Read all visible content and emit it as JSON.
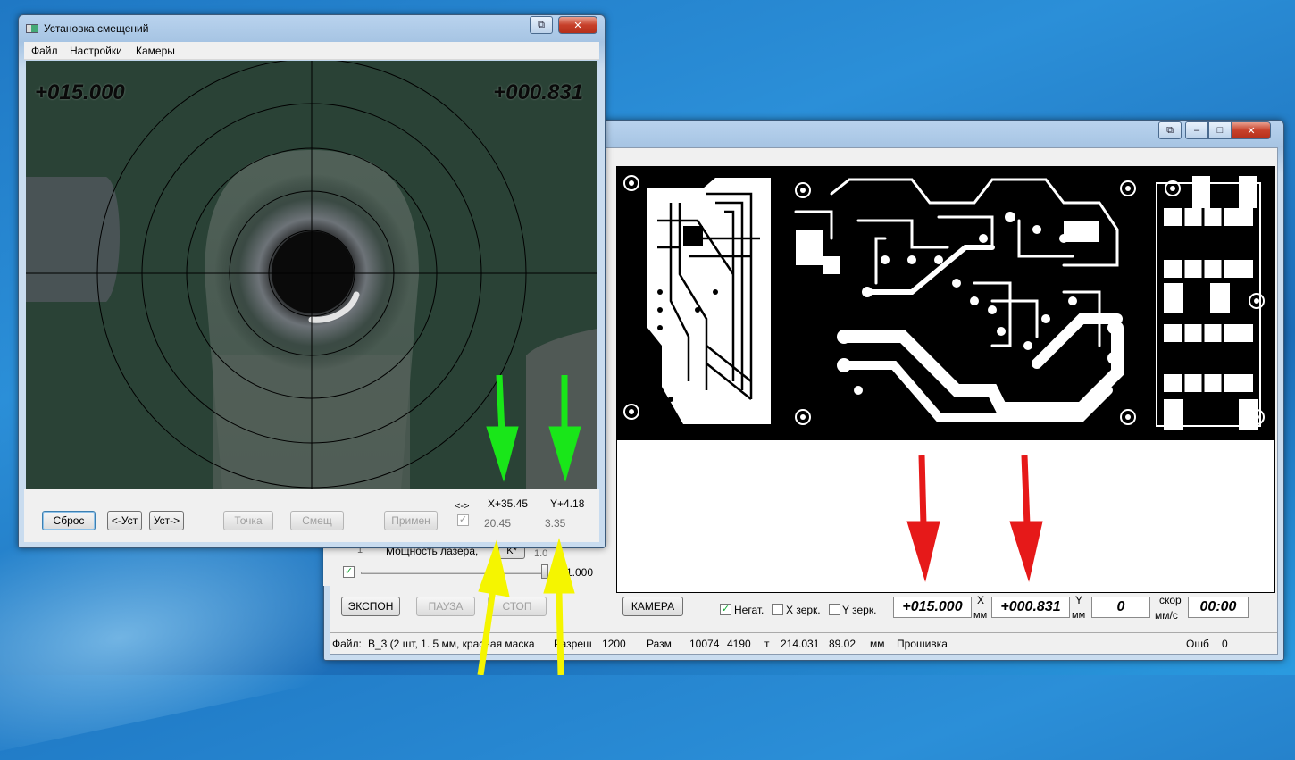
{
  "desktop": {
    "accent": "#1f78c4"
  },
  "offset_dialog": {
    "title": "Установка смещений",
    "menu": [
      "Файл",
      "Настройки",
      "Камеры"
    ],
    "camera": {
      "x_readout": "+015.000",
      "y_readout": "+000.831"
    },
    "buttons": {
      "reset": "Сброс",
      "set_left": "<-Уст",
      "set_right": "Уст->",
      "point": "Точка",
      "offset": "Смещ",
      "apply": "Примен"
    },
    "swap_label": "<->",
    "x_label": "X+35.45",
    "y_label": "Y+4.18",
    "x_value": "20.45",
    "y_value": "3.35"
  },
  "main_window": {
    "laser_power_label": "Мощность лазера,",
    "laser_power_btn": "K*",
    "partial_1": "1",
    "partial_10": "1.0",
    "laser_power_value": "1.000",
    "buttons": {
      "expose": "ЭКСПОН",
      "pause": "ПАУЗА",
      "stop": "СТОП",
      "camera": "КАМЕРА"
    },
    "checkboxes": {
      "negative": "Негат.",
      "x_mirror": "X зерк.",
      "y_mirror": "Y зерк."
    },
    "readouts": {
      "x": "+015.000",
      "y": "+000.831",
      "speed": "0",
      "time": "00:00"
    },
    "axis_labels": {
      "x": "X",
      "y": "Y",
      "unit": "мм",
      "speed_top": "скор",
      "speed_bottom": "мм/с"
    },
    "status": {
      "file_label": "Файл:",
      "file_value": "B_3 (2 шт, 1. 5 мм, красная маска",
      "resolution_label": "Разреш",
      "resolution_value": "1200",
      "size_label": "Разм",
      "size_w": "10074",
      "size_h": "4190",
      "t_label": "т",
      "t_w": "214.031",
      "t_h": "89.02",
      "unit": "мм",
      "firmware": "Прошивка",
      "error_label": "Ошб",
      "error_value": "0"
    }
  },
  "annotations": {
    "green": "#19e619",
    "yellow": "#f5f500",
    "red": "#e61919"
  }
}
